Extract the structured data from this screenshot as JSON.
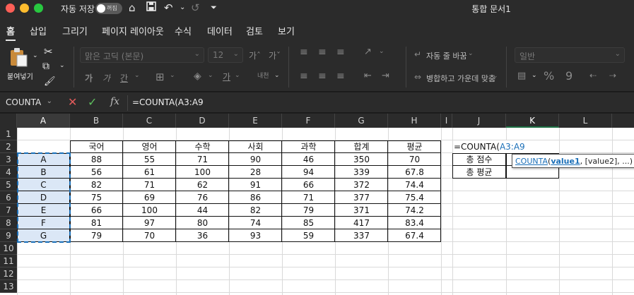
{
  "titlebar": {
    "autosave_label": "자동 저장",
    "autosave_state": "꺼짐",
    "document_title": "통합 문서1",
    "icons": [
      "home-icon",
      "save-icon",
      "undo-icon",
      "redo-icon",
      "customize-icon"
    ]
  },
  "tabs": [
    "홈",
    "삽입",
    "그리기",
    "페이지 레이아웃",
    "수식",
    "데이터",
    "검토",
    "보기"
  ],
  "ribbon": {
    "paste_label": "붙여넣기",
    "font_name": "맑은 고딕 (본문)",
    "font_size": "12",
    "wrap_text": "자동 줄 바꿈",
    "merge_center": "병합하고 가운데 맞춤",
    "number_format": "일반",
    "font_buttons": [
      "가",
      "가",
      "간"
    ],
    "font_grow": "가ˆ",
    "font_shrink": "가ˇ",
    "font_color_glyph": "가",
    "phonetic": "내천",
    "percent": "%",
    "comma": "9"
  },
  "formula_bar": {
    "name_box": "COUNTA",
    "fx": "fx",
    "formula": "=COUNTA(A3:A9"
  },
  "columns": [
    "A",
    "B",
    "C",
    "D",
    "E",
    "F",
    "G",
    "H",
    "I",
    "J",
    "K",
    "L"
  ],
  "rows": [
    "1",
    "2",
    "3",
    "4",
    "5",
    "6",
    "7",
    "8",
    "9",
    "10",
    "11",
    "12",
    "13"
  ],
  "table": {
    "headers": [
      "국어",
      "영어",
      "수학",
      "사회",
      "과학",
      "합계",
      "평균"
    ],
    "rows": [
      {
        "name": "A",
        "values": [
          "88",
          "55",
          "71",
          "90",
          "46",
          "350",
          "70"
        ]
      },
      {
        "name": "B",
        "values": [
          "56",
          "61",
          "100",
          "28",
          "94",
          "339",
          "67.8"
        ]
      },
      {
        "name": "C",
        "values": [
          "82",
          "71",
          "62",
          "91",
          "66",
          "372",
          "74.4"
        ]
      },
      {
        "name": "D",
        "values": [
          "75",
          "69",
          "76",
          "86",
          "71",
          "377",
          "75.4"
        ]
      },
      {
        "name": "E",
        "values": [
          "66",
          "100",
          "44",
          "82",
          "79",
          "371",
          "74.2"
        ]
      },
      {
        "name": "F",
        "values": [
          "81",
          "97",
          "80",
          "74",
          "85",
          "417",
          "83.4"
        ]
      },
      {
        "name": "G",
        "values": [
          "79",
          "70",
          "36",
          "93",
          "59",
          "337",
          "67.4"
        ]
      }
    ]
  },
  "summary": {
    "edit_prefix": "=COUNTA(",
    "edit_ref": "A3:A9",
    "labels": [
      "총 점수",
      "총 평균"
    ]
  },
  "tooltip": {
    "fn": "COUNTA",
    "open": "(",
    "arg1": "value1",
    "rest": ", [value2], ...)"
  }
}
